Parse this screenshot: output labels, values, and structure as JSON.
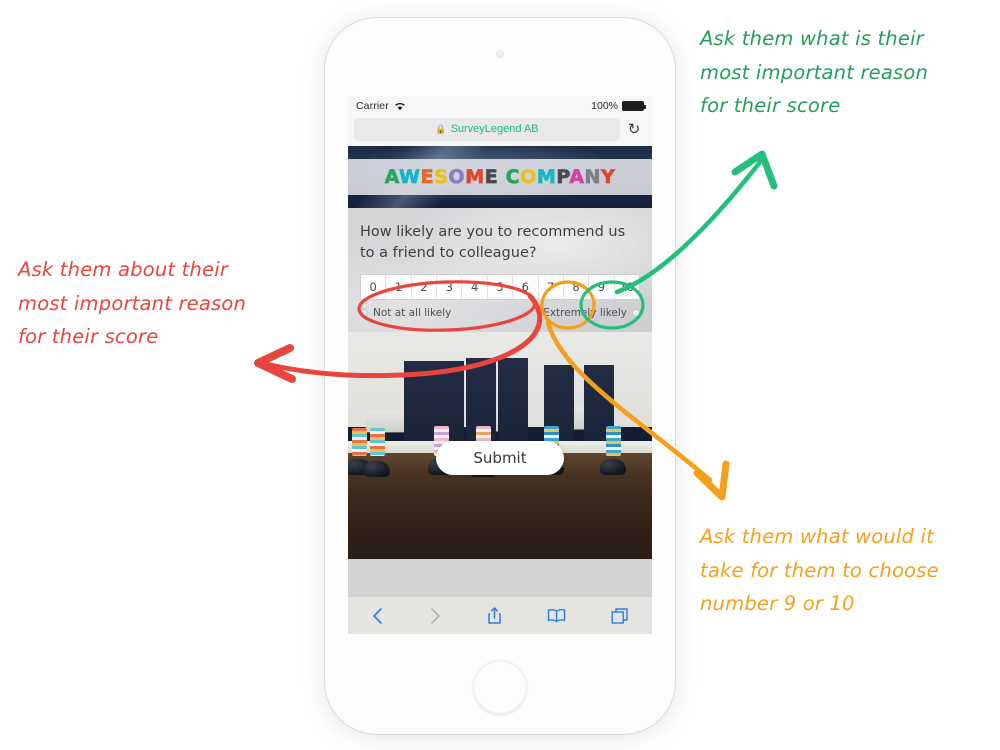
{
  "phone": {
    "status_bar": {
      "carrier": "Carrier",
      "wifi_icon": "wifi-icon",
      "battery_percent": "100%",
      "battery_icon": "battery-full-icon"
    },
    "browser": {
      "lock_icon": "lock-icon",
      "url_text": "SurveyLegend AB",
      "reload_icon": "reload-icon",
      "toolbar": [
        {
          "name": "back-button",
          "glyph": "back-chevron-icon"
        },
        {
          "name": "forward-button",
          "glyph": "forward-chevron-icon"
        },
        {
          "name": "share-button",
          "glyph": "share-icon"
        },
        {
          "name": "bookmarks-button",
          "glyph": "book-icon"
        },
        {
          "name": "tabs-button",
          "glyph": "tabs-icon"
        }
      ]
    }
  },
  "survey": {
    "logo": {
      "text": "AWESOME COMPANY",
      "letters": [
        {
          "ch": "A",
          "color": "#2aa35c"
        },
        {
          "ch": "W",
          "color": "#18b6c4"
        },
        {
          "ch": "E",
          "color": "#e06a27"
        },
        {
          "ch": "S",
          "color": "#e8c020"
        },
        {
          "ch": "O",
          "color": "#8a7fc4"
        },
        {
          "ch": "M",
          "color": "#e0452f"
        },
        {
          "ch": "E",
          "color": "#4a4a52"
        },
        {
          "ch": " ",
          "color": "#4a4a52"
        },
        {
          "ch": "C",
          "color": "#2aa35c"
        },
        {
          "ch": "O",
          "color": "#e8c020"
        },
        {
          "ch": "M",
          "color": "#18b6c4"
        },
        {
          "ch": "P",
          "color": "#4a4a52"
        },
        {
          "ch": "A",
          "color": "#d53fa0"
        },
        {
          "ch": "N",
          "color": "#7f7f88"
        },
        {
          "ch": "Y",
          "color": "#e0452f"
        }
      ]
    },
    "question": "How likely are you to recommend us to a friend to colleague?",
    "scale": [
      "0",
      "1",
      "2",
      "3",
      "4",
      "5",
      "6",
      "7",
      "8",
      "9",
      "10"
    ],
    "low_label": "Not at all likely",
    "high_label": "Extremely likely",
    "submit_label": "Submit"
  },
  "annotations": [
    {
      "id": "green",
      "text": "Ask them what is their\nmost important reason\nfor their score",
      "color": "#22a05b",
      "marker": "circle around 9 and 10"
    },
    {
      "id": "red",
      "text": "Ask them about their\nmost important reason\nfor their score",
      "color": "#e8453c",
      "marker": "circle around 0 through 6"
    },
    {
      "id": "orange",
      "text": "Ask them what would it\ntake for them to choose\nnumber 9 or 10",
      "color": "#f5a01b",
      "marker": "circle around 7 and 8"
    }
  ]
}
